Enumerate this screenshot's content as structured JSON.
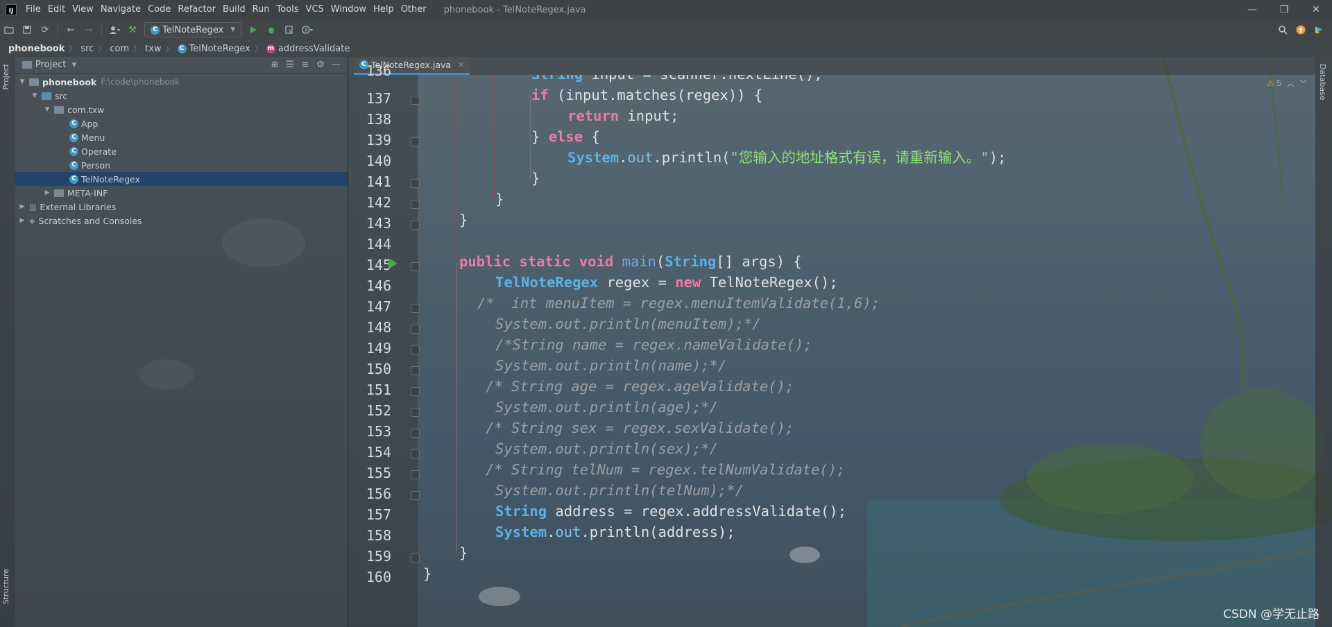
{
  "window": {
    "title": "phonebook - TelNoteRegex.java",
    "menu": [
      "File",
      "Edit",
      "View",
      "Navigate",
      "Code",
      "Refactor",
      "Build",
      "Run",
      "Tools",
      "VCS",
      "Window",
      "Help",
      "Other"
    ],
    "controls": {
      "minimize": "—",
      "restore": "❐",
      "close": "✕"
    }
  },
  "toolbar": {
    "run_config": "TelNoteRegex"
  },
  "breadcrumb": [
    "phonebook",
    "src",
    "com",
    "txw",
    "TelNoteRegex",
    "addressValidate"
  ],
  "left_strip": {
    "project_tab": "Project",
    "structure_tab": "Structure"
  },
  "project_panel": {
    "title": "Project",
    "tree": [
      {
        "label": "phonebook",
        "path": "F:\\code\\phonebook"
      },
      {
        "label": "src"
      },
      {
        "label": "com.txw"
      },
      {
        "label": "App"
      },
      {
        "label": "Menu"
      },
      {
        "label": "Operate"
      },
      {
        "label": "Person"
      },
      {
        "label": "TelNoteRegex"
      },
      {
        "label": "META-INF"
      },
      {
        "label": "External Libraries"
      },
      {
        "label": "Scratches and Consoles"
      }
    ]
  },
  "editor": {
    "tab": "TelNoteRegex.java",
    "inspection_count": "5",
    "line_numbers": [
      "136",
      "137",
      "138",
      "139",
      "140",
      "141",
      "142",
      "143",
      "144",
      "145",
      "146",
      "147",
      "148",
      "149",
      "150",
      "151",
      "152",
      "153",
      "154",
      "155",
      "156",
      "157",
      "158",
      "159",
      "160"
    ]
  },
  "right_strip": {
    "database_tab": "Database"
  },
  "watermark": "CSDN @学无止路",
  "colors": {
    "keyword": "#f07aa6",
    "type": "#5cb2e8",
    "string": "#8fe07a",
    "comment": "#9aa0a6",
    "selection": "#21426c",
    "run_gutter": "#4fa64f"
  }
}
